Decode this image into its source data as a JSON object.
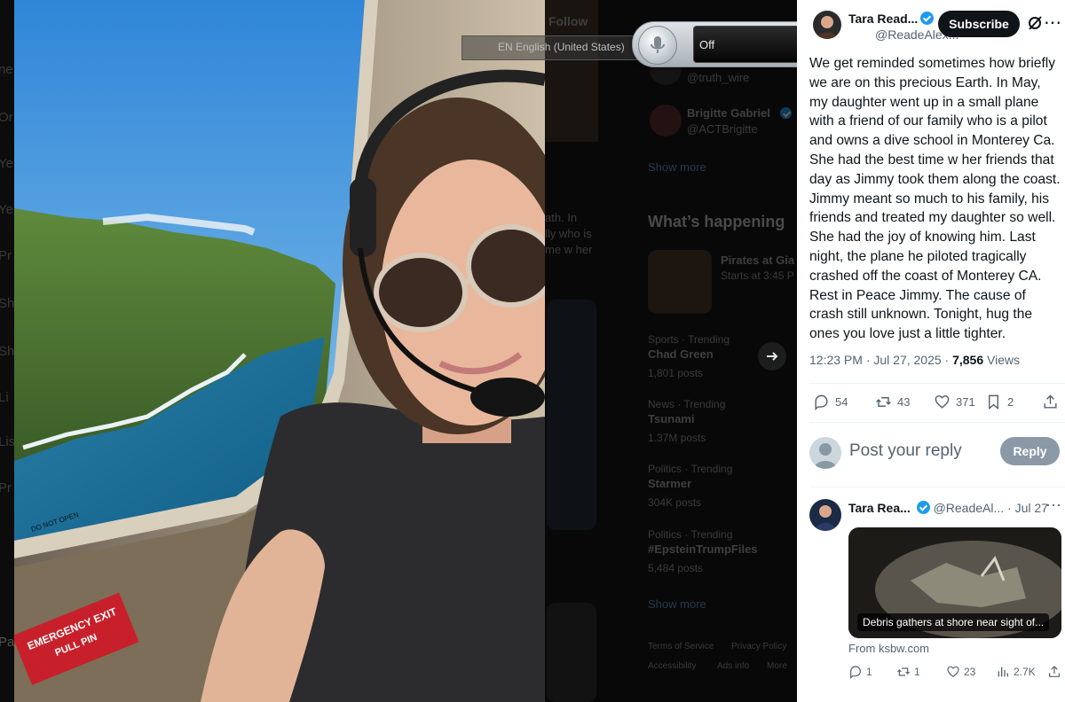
{
  "sidebar_fragments": [
    "ne",
    "Or",
    "Ye",
    "Ye",
    "Pr",
    "Sh",
    "Sh",
    "Li",
    "Lis",
    "Pr",
    "Pa"
  ],
  "background_feed": {
    "follow_label": "Follow",
    "who_to_follow": [
      {
        "name": "",
        "handle": "@truth_wire"
      },
      {
        "name": "Brigitte Gabriel",
        "handle": "@ACTBrigitte"
      }
    ],
    "show_more": "Show more",
    "whats_happening": "What’s happening",
    "post_fragments": [
      "ath. In",
      "lly who is",
      "me w her"
    ],
    "event": {
      "title": "Pirates at Gia",
      "subtitle": "Starts at 3:45 P"
    },
    "trends": [
      {
        "context": "Sports · Trending",
        "name": "Chad Green",
        "posts": "1,801 posts"
      },
      {
        "context": "News · Trending",
        "name": "Tsunami",
        "posts": "1.37M posts"
      },
      {
        "context": "Politics · Trending",
        "name": "Starmer",
        "posts": "304K posts"
      },
      {
        "context": "Politics · Trending",
        "name": "#EpsteinTrumpFiles",
        "posts": "5,484 posts"
      }
    ],
    "show_more_2": "Show more",
    "footer_links": [
      "Terms of Service",
      "Privacy Policy",
      "Accessibility",
      "Ads info",
      "More"
    ]
  },
  "language_bar": {
    "label": "EN English (United States)"
  },
  "speech_widget": {
    "status": "Off"
  },
  "photo": {
    "exit_label": "EMERGENCY EXIT",
    "exit_sub": "PULL PIN",
    "window_sticker": "DO NOT OPEN"
  },
  "post": {
    "author_name": "Tara Read...",
    "author_handle": "@ReadeAlex...",
    "subscribe_label": "Subscribe",
    "text": "We get reminded sometimes how briefly we are on this precious Earth. In May, my daughter went up in a small plane with a friend of our family who is a pilot and owns a dive school in Monterey Ca. She had the best time w her friends that day as Jimmy took them along the coast. Jimmy meant so much to his family, his friends and treated my daughter so well. She had the joy of knowing him. Last night, the plane he piloted tragically crashed off the coast of Monterey CA. Rest in Peace Jimmy. The cause of crash still unknown. Tonight, hug the ones you love just a little tighter.",
    "timestamp": "12:23 PM · Jul 27, 2025 · ",
    "views_count": "7,856",
    "views_label": " Views",
    "replies": "54",
    "reposts": "43",
    "likes": "371",
    "bookmarks": "2"
  },
  "reply_box": {
    "placeholder": "Post your reply",
    "button": "Reply"
  },
  "reply": {
    "author_name": "Tara Rea...",
    "author_handle": "@ReadeAl...",
    "date": "· Jul 27",
    "card_caption": "Debris gathers at shore near sight of...",
    "card_source": "From ksbw.com",
    "replies": "1",
    "reposts": "1",
    "likes": "23",
    "views": "2.7K"
  },
  "colors": {
    "accent": "#1d9bf0",
    "dark": "#0f1419",
    "muted": "#536471",
    "reply_btn": "#8b98a5"
  }
}
